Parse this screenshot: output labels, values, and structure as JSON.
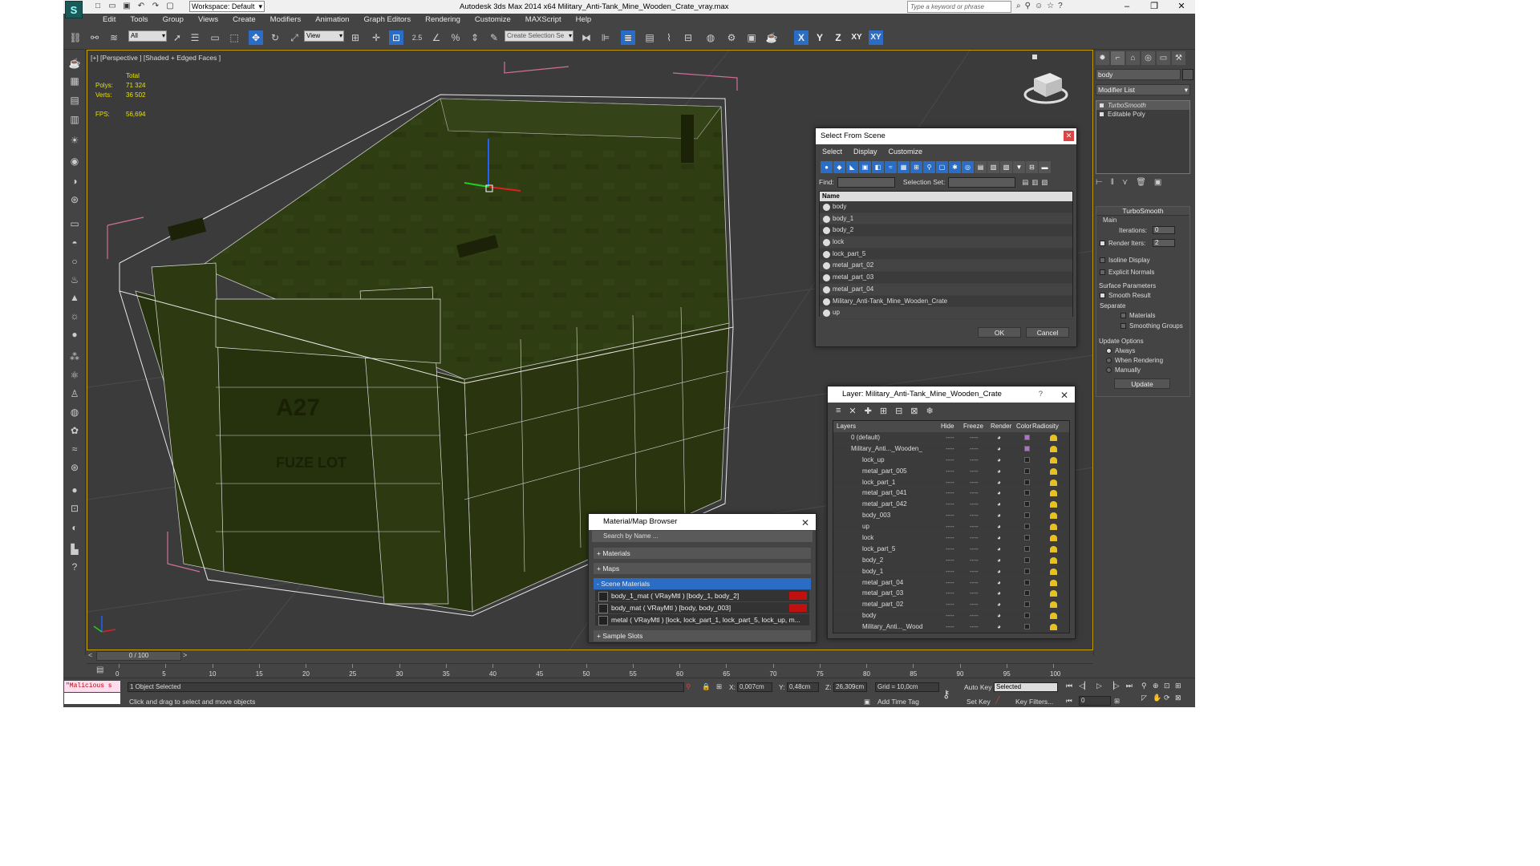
{
  "window": {
    "title": "Autodesk 3ds Max  2014 x64     Military_Anti-Tank_Mine_Wooden_Crate_vray.max",
    "workspace": "Workspace: Default",
    "search_placeholder": "Type a keyword or phrase",
    "controls": [
      "–",
      "❐",
      "✕"
    ]
  },
  "menu": [
    "Edit",
    "Tools",
    "Group",
    "Views",
    "Create",
    "Modifiers",
    "Animation",
    "Graph Editors",
    "Rendering",
    "Customize",
    "MAXScript",
    "Help"
  ],
  "toolbar": {
    "filter": "All",
    "ref_coord": "View",
    "selection_set": "Create Selection Se",
    "snap_label": "2.5",
    "axes": [
      "X",
      "Y",
      "Z",
      "XY",
      "XY"
    ]
  },
  "viewport": {
    "label": "[+] [Perspective ] [Shaded + Edged Faces ]",
    "stats": {
      "total_label": "Total",
      "polys_label": "Polys:",
      "polys": "71 324",
      "verts_label": "Verts:",
      "verts": "36 502",
      "fps_label": "FPS:",
      "fps": "56,694"
    },
    "crate_text": [
      "A27",
      "FUZE LOT"
    ]
  },
  "command_panel": {
    "object_name": "body",
    "modifier_list": "Modifier List",
    "stack": [
      "TurboSmooth",
      "Editable Poly"
    ],
    "turbosmooth": {
      "title": "TurboSmooth",
      "main": "Main",
      "iterations_label": "Iterations:",
      "iterations": "0",
      "render_iters_label": "Render Iters:",
      "render_iters": "2",
      "isoline": "Isoline Display",
      "explicit": "Explicit Normals",
      "surface_params": "Surface Parameters",
      "smooth_result": "Smooth Result",
      "separate": "Separate",
      "materials": "Materials",
      "smoothing_groups": "Smoothing Groups",
      "update_options": "Update Options",
      "always": "Always",
      "when_rendering": "When Rendering",
      "manually": "Manually",
      "update": "Update"
    }
  },
  "select_from_scene": {
    "title": "Select From Scene",
    "menu": [
      "Select",
      "Display",
      "Customize"
    ],
    "find_label": "Find:",
    "selset_label": "Selection Set:",
    "column": "Name",
    "items": [
      "body",
      "body_1",
      "body_2",
      "lock",
      "lock_part_5",
      "metal_part_02",
      "metal_part_03",
      "metal_part_04",
      "Military_Anti-Tank_Mine_Wooden_Crate",
      "up"
    ],
    "ok": "OK",
    "cancel": "Cancel"
  },
  "layer_explorer": {
    "title": "Layer: Military_Anti-Tank_Mine_Wooden_Crate",
    "columns": [
      "Layers",
      "Hide",
      "Freeze",
      "Render",
      "Color",
      "Radiosity"
    ],
    "rows": [
      {
        "name": "0 (default)",
        "indent": 0,
        "color": "#b070d0"
      },
      {
        "name": "Military_Anti..._Wooden_",
        "indent": 0,
        "color": "#b070d0"
      },
      {
        "name": "lock_up",
        "indent": 1,
        "color": "#222222"
      },
      {
        "name": "metal_part_005",
        "indent": 1,
        "color": "#222222"
      },
      {
        "name": "lock_part_1",
        "indent": 1,
        "color": "#222222"
      },
      {
        "name": "metal_part_041",
        "indent": 1,
        "color": "#222222"
      },
      {
        "name": "metal_part_042",
        "indent": 1,
        "color": "#222222"
      },
      {
        "name": "body_003",
        "indent": 1,
        "color": "#222222"
      },
      {
        "name": "up",
        "indent": 1,
        "color": "#222222"
      },
      {
        "name": "lock",
        "indent": 1,
        "color": "#222222"
      },
      {
        "name": "lock_part_5",
        "indent": 1,
        "color": "#222222"
      },
      {
        "name": "body_2",
        "indent": 1,
        "color": "#222222"
      },
      {
        "name": "body_1",
        "indent": 1,
        "color": "#222222"
      },
      {
        "name": "metal_part_04",
        "indent": 1,
        "color": "#222222"
      },
      {
        "name": "metal_part_03",
        "indent": 1,
        "color": "#222222"
      },
      {
        "name": "metal_part_02",
        "indent": 1,
        "color": "#222222"
      },
      {
        "name": "body",
        "indent": 1,
        "color": "#222222"
      },
      {
        "name": "Military_Anti..._Wood",
        "indent": 1,
        "color": "#222222"
      }
    ],
    "cell_dash": "----"
  },
  "material_browser": {
    "title": "Material/Map Browser",
    "search_placeholder": "Search by Name ...",
    "sections": [
      "+ Materials",
      "+ Maps",
      "- Scene Materials",
      "+ Sample Slots"
    ],
    "materials": [
      "body_1_mat  ( VRayMtl )  [body_1, body_2]",
      "body_mat  ( VRayMtl )  [body, body_003]",
      "metal  ( VRayMtl )  [lock, lock_part_1, lock_part_5, lock_up, m..."
    ]
  },
  "timeline": {
    "frame": "0 / 100",
    "ticks": [
      "0",
      "5",
      "10",
      "15",
      "20",
      "25",
      "30",
      "35",
      "40",
      "45",
      "50",
      "55",
      "60",
      "65",
      "70",
      "75",
      "80",
      "85",
      "90",
      "95",
      "100"
    ]
  },
  "status": {
    "maxscript": "\"Malicious s",
    "selected": "1 Object Selected",
    "prompt": "Click and drag to select and move objects",
    "x_label": "X:",
    "x": "0,007cm",
    "y_label": "Y:",
    "y": "0,48cm",
    "z_label": "Z:",
    "z": "26,309cm",
    "grid": "Grid = 10,0cm",
    "add_time_tag": "Add Time Tag",
    "auto_key": "Auto Key",
    "set_key": "Set Key",
    "selected_dropdown": "Selected",
    "key_filters": "Key Filters...",
    "frame_value": "0"
  }
}
